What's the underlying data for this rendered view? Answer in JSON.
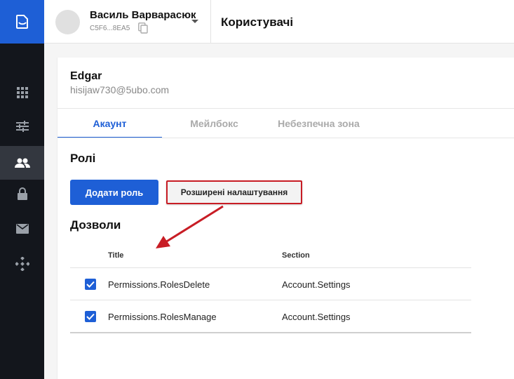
{
  "header": {
    "user_name": "Василь Варварасюк",
    "user_id": "C5F6...8EA5",
    "page_title": "Користувачі"
  },
  "sidebar": {
    "items": [
      {
        "icon": "grid-icon"
      },
      {
        "icon": "sliders-icon"
      },
      {
        "icon": "users-icon",
        "active": true
      },
      {
        "icon": "lock-icon"
      },
      {
        "icon": "mail-icon"
      },
      {
        "icon": "integrations-icon"
      }
    ]
  },
  "profile": {
    "name": "Edgar",
    "email": "hisijaw730@5ubo.com"
  },
  "tabs": [
    {
      "label": "Акаунт",
      "active": true
    },
    {
      "label": "Мейлбокс"
    },
    {
      "label": "Небезпечна зона"
    }
  ],
  "roles": {
    "title": "Ролі",
    "add_role_label": "Додати роль",
    "advanced_label": "Розширені налаштування"
  },
  "permissions": {
    "title": "Дозволи",
    "columns": [
      "Title",
      "Section"
    ],
    "rows": [
      {
        "checked": true,
        "title": "Permissions.RolesDelete",
        "section": "Account.Settings"
      },
      {
        "checked": true,
        "title": "Permissions.RolesManage",
        "section": "Account.Settings"
      }
    ]
  },
  "colors": {
    "accent": "#1e5fd6",
    "sidebar_bg": "#13161c",
    "highlight_red": "#c81d25"
  }
}
